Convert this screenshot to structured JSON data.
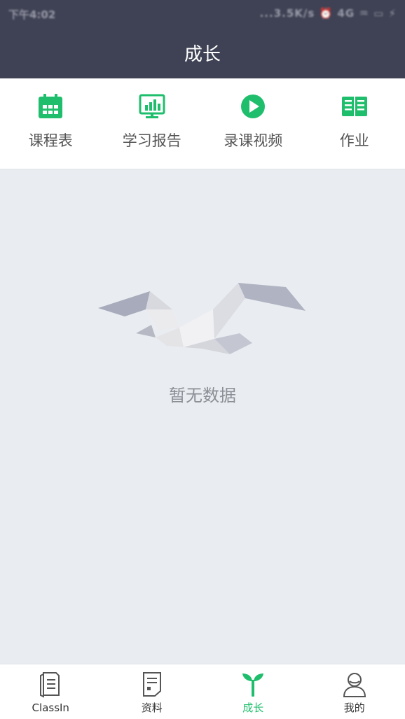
{
  "colors": {
    "header_bg": "#3f4254",
    "accent": "#1fbe6c",
    "page_bg": "#e9edf1"
  },
  "status_bar": {
    "time": "下午4:02",
    "indicators": "...3.5K/s ⏰ 4G ♒ ▭ ⚡"
  },
  "header": {
    "title": "成长"
  },
  "quick_menu": [
    {
      "label": "课程表",
      "icon": "calendar-icon"
    },
    {
      "label": "学习报告",
      "icon": "report-chart-icon"
    },
    {
      "label": "录课视频",
      "icon": "play-video-icon"
    },
    {
      "label": "作业",
      "icon": "book-icon"
    }
  ],
  "empty_state": {
    "image": "origami-bird-icon",
    "text": "暂无数据"
  },
  "tabbar": [
    {
      "label": "ClassIn",
      "icon": "classin-doc-icon",
      "active": false
    },
    {
      "label": "资料",
      "icon": "materials-icon",
      "active": false
    },
    {
      "label": "成长",
      "icon": "sprout-icon",
      "active": true
    },
    {
      "label": "我的",
      "icon": "profile-icon",
      "active": false
    }
  ]
}
